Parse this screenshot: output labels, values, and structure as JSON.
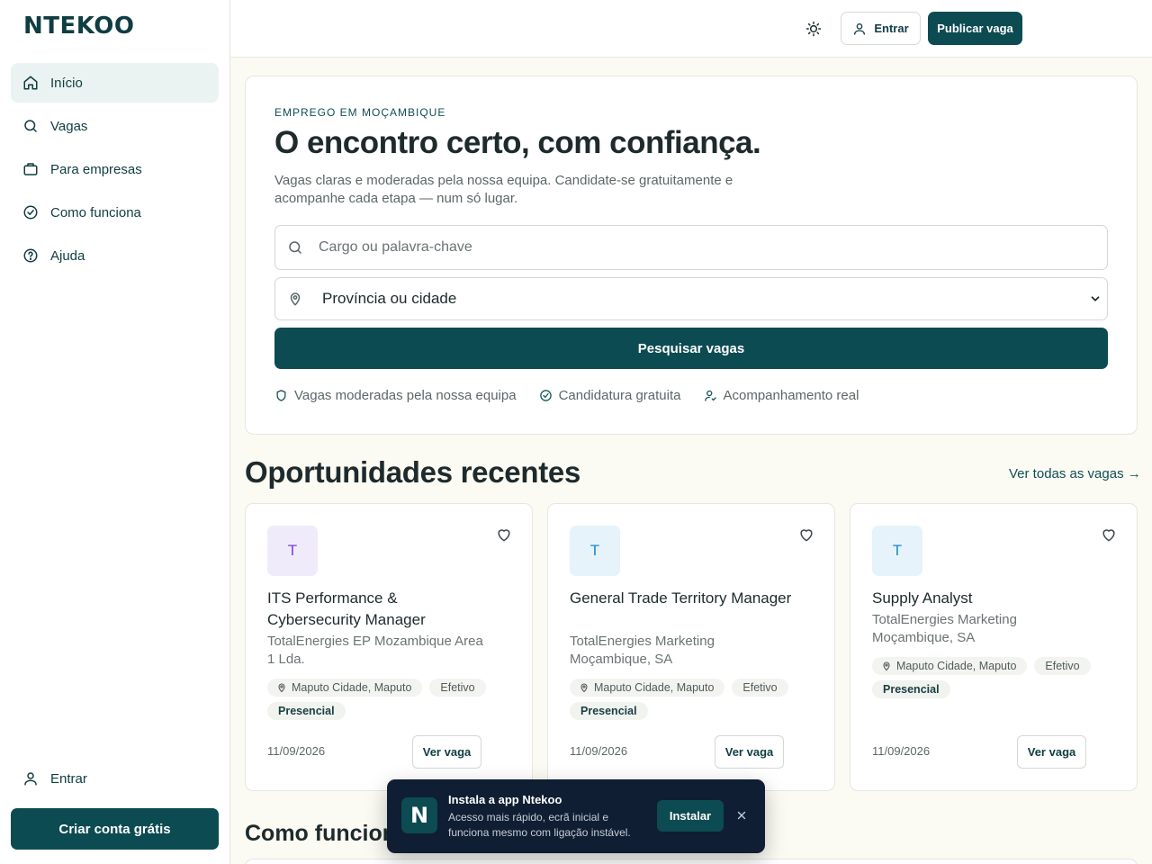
{
  "brand": {
    "logo": "NTEKOO"
  },
  "sidebar": {
    "items": [
      {
        "label": "Início",
        "icon": "home-icon",
        "active": true
      },
      {
        "label": "Vagas",
        "icon": "search-icon"
      },
      {
        "label": "Para empresas",
        "icon": "briefcase-icon"
      },
      {
        "label": "Como funciona",
        "icon": "check-circle-icon"
      },
      {
        "label": "Ajuda",
        "icon": "help-circle-icon"
      }
    ],
    "login_label": "Entrar",
    "create_account_label": "Criar conta grátis"
  },
  "topbar": {
    "theme_icon": "sun-icon",
    "login_label": "Entrar",
    "publish_label": "Publicar vaga"
  },
  "hero": {
    "eyebrow": "EMPREGO EM MOÇAMBIQUE",
    "title": "O encontro certo, com confiança.",
    "subtitle": "Vagas claras e moderadas pela nossa equipa. Candidate-se gratuitamente e acompanhe cada etapa — num só lugar.",
    "search_placeholder": "Cargo ou palavra-chave",
    "location_value": "Província ou cidade",
    "search_button": "Pesquisar vagas",
    "features": [
      {
        "icon": "shield-icon",
        "label": "Vagas moderadas pela nossa equipa"
      },
      {
        "icon": "check-circle-icon",
        "label": "Candidatura gratuita"
      },
      {
        "icon": "user-check-icon",
        "label": "Acompanhamento real"
      }
    ]
  },
  "recent": {
    "title": "Oportunidades recentes",
    "see_all": "Ver todas as vagas →",
    "jobs": [
      {
        "initial": "T",
        "avatar_bg": "#f0ebfb",
        "avatar_fg": "#7b3fe0",
        "title": "ITS Performance & Cybersecurity Manager",
        "company": "TotalEnergies EP Mozambique Area 1 Lda.",
        "location": "Maputo Cidade, Maputo",
        "contract": "Efetivo",
        "mode": "Presencial",
        "date": "11/09/2026",
        "view_label": "Ver vaga"
      },
      {
        "initial": "T",
        "avatar_bg": "#e6f3fb",
        "avatar_fg": "#1e88c8",
        "title": "General Trade Territory Manager",
        "company": "TotalEnergies Marketing Moçambique, SA",
        "location": "Maputo Cidade, Maputo",
        "contract": "Efetivo",
        "mode": "Presencial",
        "date": "11/09/2026",
        "view_label": "Ver vaga"
      },
      {
        "initial": "T",
        "avatar_bg": "#e6f3fb",
        "avatar_fg": "#1e88c8",
        "title": "Supply Analyst",
        "company": "TotalEnergies Marketing Moçambique, SA",
        "location": "Maputo Cidade, Maputo",
        "contract": "Efetivo",
        "mode": "Presencial",
        "date": "11/09/2026",
        "view_label": "Ver vaga"
      }
    ]
  },
  "how": {
    "title": "Como funciona"
  },
  "install_banner": {
    "logo_letter": "N",
    "title": "Instala a app Ntekoo",
    "text": "Acesso mais rápido, ecrã inicial e funciona mesmo com ligação instável.",
    "button": "Instalar"
  },
  "colors": {
    "primary": "#0d4b52",
    "background": "#fbfaf3",
    "banner": "#0f1e33"
  }
}
